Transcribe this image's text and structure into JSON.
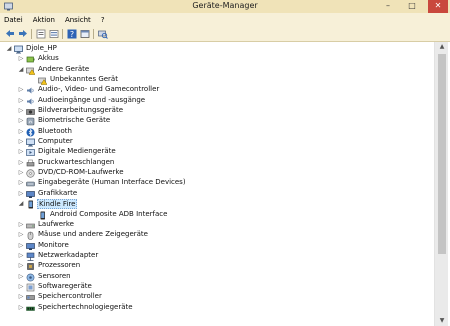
{
  "window": {
    "title": "Geräte-Manager",
    "min_glyph": "–",
    "max_glyph": "□",
    "close_glyph": "✕"
  },
  "menu": [
    "Datei",
    "Aktion",
    "Ansicht",
    "?"
  ],
  "toolbar": {
    "buttons": [
      "back-arrow-icon",
      "forward-arrow-icon",
      "properties-icon",
      "device-list-icon",
      "help-icon",
      "view-icon",
      "scan-hardware-icon"
    ]
  },
  "tree": [
    {
      "level": 0,
      "exp": "◢",
      "icon": "computer",
      "label": "Djole_HP"
    },
    {
      "level": 1,
      "exp": "▷",
      "icon": "battery",
      "label": "Akkus"
    },
    {
      "level": 1,
      "exp": "◢",
      "icon": "warning-device",
      "label": "Andere Geräte"
    },
    {
      "level": 2,
      "exp": "",
      "icon": "warning-device",
      "label": "Unbekanntes Gerät"
    },
    {
      "level": 1,
      "exp": "▷",
      "icon": "audio",
      "label": "Audio-, Video- und Gamecontroller"
    },
    {
      "level": 1,
      "exp": "▷",
      "icon": "audio",
      "label": "Audioeingänge und -ausgänge"
    },
    {
      "level": 1,
      "exp": "▷",
      "icon": "camera",
      "label": "Bildverarbeitungsgeräte"
    },
    {
      "level": 1,
      "exp": "▷",
      "icon": "biometric",
      "label": "Biometrische Geräte"
    },
    {
      "level": 1,
      "exp": "▷",
      "icon": "bluetooth",
      "label": "Bluetooth"
    },
    {
      "level": 1,
      "exp": "▷",
      "icon": "computer",
      "label": "Computer"
    },
    {
      "level": 1,
      "exp": "▷",
      "icon": "media",
      "label": "Digitale Mediengeräte"
    },
    {
      "level": 1,
      "exp": "▷",
      "icon": "printer",
      "label": "Druckwarteschlangen"
    },
    {
      "level": 1,
      "exp": "▷",
      "icon": "disc",
      "label": "DVD/CD-ROM-Laufwerke"
    },
    {
      "level": 1,
      "exp": "▷",
      "icon": "hid",
      "label": "Eingabegeräte (Human Interface Devices)"
    },
    {
      "level": 1,
      "exp": "▷",
      "icon": "display",
      "label": "Grafikkarte"
    },
    {
      "level": 1,
      "exp": "◢",
      "icon": "phone",
      "label": "Kindle Fire",
      "selected": true
    },
    {
      "level": 2,
      "exp": "",
      "icon": "phone",
      "label": "Android Composite ADB Interface"
    },
    {
      "level": 1,
      "exp": "▷",
      "icon": "drive",
      "label": "Laufwerke"
    },
    {
      "level": 1,
      "exp": "▷",
      "icon": "mouse",
      "label": "Mäuse und andere Zeigegeräte"
    },
    {
      "level": 1,
      "exp": "▷",
      "icon": "display",
      "label": "Monitore"
    },
    {
      "level": 1,
      "exp": "▷",
      "icon": "network",
      "label": "Netzwerkadapter"
    },
    {
      "level": 1,
      "exp": "▷",
      "icon": "processor",
      "label": "Prozessoren"
    },
    {
      "level": 1,
      "exp": "▷",
      "icon": "sensor",
      "label": "Sensoren"
    },
    {
      "level": 1,
      "exp": "▷",
      "icon": "software",
      "label": "Softwaregeräte"
    },
    {
      "level": 1,
      "exp": "▷",
      "icon": "storage",
      "label": "Speichercontroller"
    },
    {
      "level": 1,
      "exp": "▷",
      "icon": "memory",
      "label": "Speichertechnologiegeräte"
    }
  ]
}
